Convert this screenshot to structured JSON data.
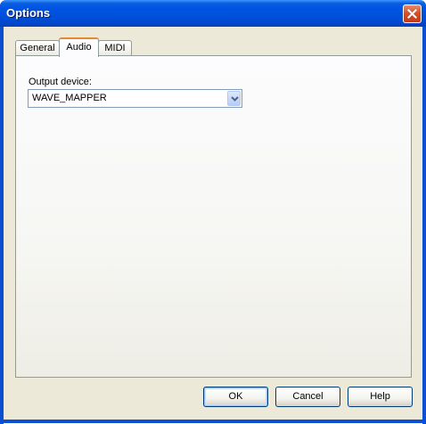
{
  "window": {
    "title": "Options"
  },
  "tabs": [
    {
      "label": "General",
      "active": false
    },
    {
      "label": "Audio",
      "active": true
    },
    {
      "label": "MIDI",
      "active": false
    }
  ],
  "audio": {
    "output_device_label": "Output device:",
    "output_device_value": "WAVE_MAPPER"
  },
  "buttons": {
    "ok": "OK",
    "cancel": "Cancel",
    "help": "Help"
  },
  "icons": {
    "close": "close-icon",
    "dropdown": "chevron-down-icon"
  },
  "colors": {
    "titlebar": "#0054e3",
    "close_button": "#d8502a",
    "active_tab_accent": "#e68b2c",
    "dialog_background": "#ece9d8"
  }
}
